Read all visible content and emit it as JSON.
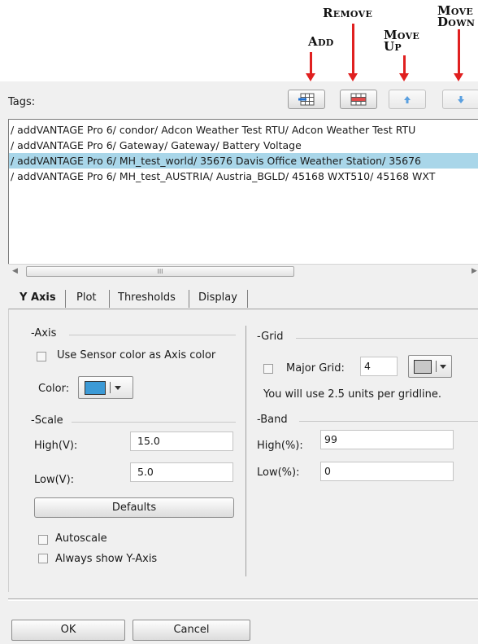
{
  "callouts": {
    "add": "Add",
    "remove": "Remove",
    "move_up_1": "Move",
    "move_up_2": "Up",
    "move_down_1": "Move",
    "move_down_2": "Down"
  },
  "tags": {
    "label": "Tags:",
    "items": [
      "/ addVANTAGE Pro 6/ condor/ Adcon Weather Test RTU/ Adcon Weather Test RTU",
      "/ addVANTAGE Pro 6/ Gateway/ Gateway/ Battery Voltage",
      "/ addVANTAGE Pro 6/ MH_test_world/ 35676 Davis Office Weather Station/ 35676",
      "/ addVANTAGE Pro 6/ MH_test_AUSTRIA/ Austria_BGLD/ 45168 WXT510/ 45168 WXT"
    ],
    "selected_index": 2,
    "scroll_thumb_glyph": "III"
  },
  "tabs": [
    "Y Axis",
    "Plot",
    "Thresholds",
    "Display"
  ],
  "active_tab": "Y Axis",
  "axis": {
    "group_label": "Axis",
    "use_sensor_color_label": "Use Sensor color as Axis color",
    "use_sensor_color_checked": false,
    "color_label": "Color:",
    "color_value": "#3c9ad6"
  },
  "scale": {
    "group_label": "Scale",
    "high_label": "High(V):",
    "high_value": "15.0",
    "low_label": "Low(V):",
    "low_value": "5.0",
    "defaults_label": "Defaults",
    "autoscale_label": "Autoscale",
    "autoscale_checked": false,
    "always_show_label": "Always show Y-Axis",
    "always_show_checked": false
  },
  "grid": {
    "group_label": "Grid",
    "major_grid_label": "Major Grid:",
    "major_grid_checked": false,
    "major_grid_value": "4",
    "grid_color_value": "#c8c8c8",
    "units_note": "You will use 2.5 units per gridline."
  },
  "band": {
    "group_label": "Band",
    "high_label": "High(%):",
    "high_value": "99",
    "low_label": "Low(%):",
    "low_value": "0"
  },
  "footer": {
    "ok_label": "OK",
    "cancel_label": "Cancel"
  }
}
